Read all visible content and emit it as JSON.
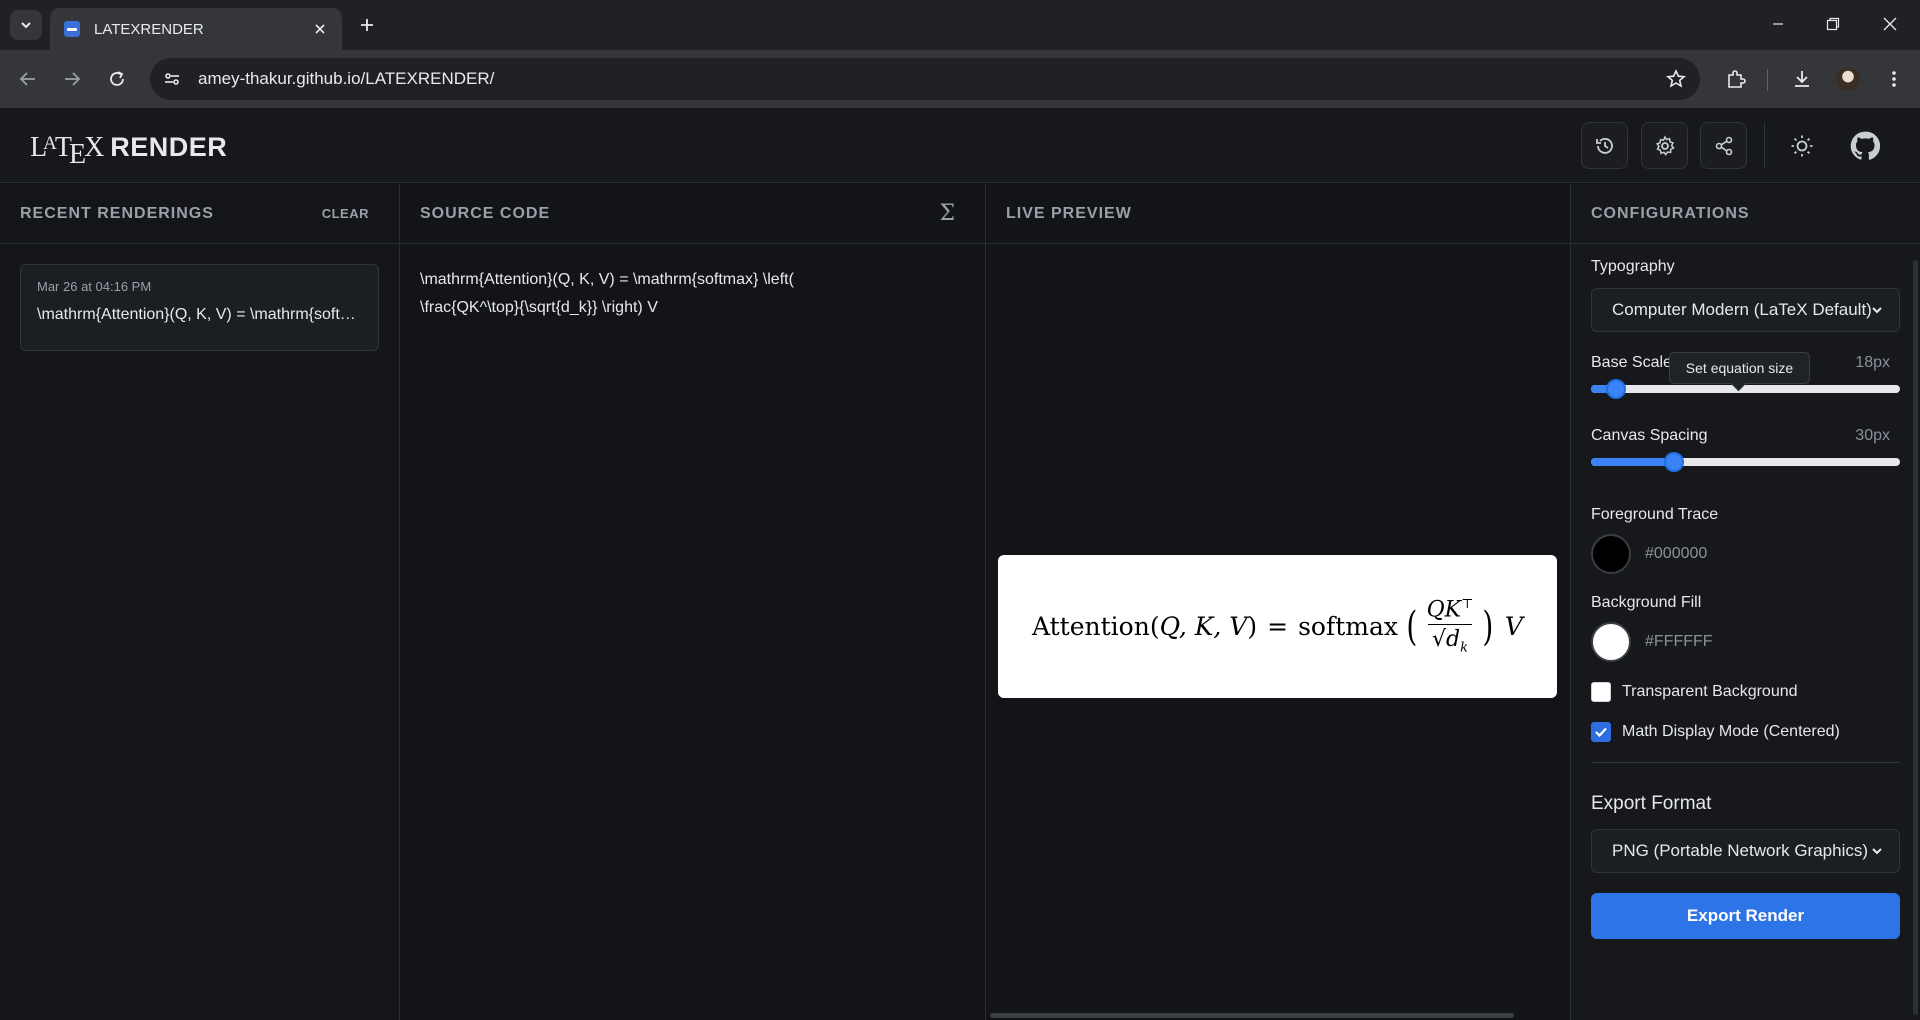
{
  "browser": {
    "tab_title": "LATEXRENDER",
    "url": "amey-thakur.github.io/LATEXRENDER/"
  },
  "app": {
    "logo": {
      "l": "L",
      "a": "A",
      "t": "T",
      "e": "E",
      "x": "X",
      "render": "RENDER"
    }
  },
  "recent": {
    "title": "RECENT RENDERINGS",
    "clear_label": "CLEAR",
    "items": [
      {
        "date": "Mar 26 at 04:16 PM",
        "code": "\\mathrm{Attention}(Q, K, V) = \\mathrm{softmax} \\left( \\frac{QK^\\top}{\\sqrt{d_k}} \\right) V"
      }
    ]
  },
  "source": {
    "title": "SOURCE CODE",
    "code": "\\mathrm{Attention}(Q, K, V) = \\mathrm{softmax} \\left(\n\\frac{QK^\\top}{\\sqrt{d_k}} \\right) V"
  },
  "preview": {
    "title": "LIVE PREVIEW",
    "formula": {
      "attention": "Attention",
      "lparen": "(",
      "args": "Q, K, V",
      "rparen": ")",
      "equals": "=",
      "softmax": "softmax",
      "num": "QK",
      "num_sup": "⊤",
      "den_root": "√",
      "den": "d",
      "den_sub": "k",
      "v": "V"
    }
  },
  "config": {
    "title": "CONFIGURATIONS",
    "typography_label": "Typography",
    "typography_value": "Computer Modern (LaTeX Default)",
    "base_scale_label": "Base Scale",
    "base_scale_value": "18px",
    "base_scale_fraction": 0.08,
    "tooltip": "Set equation size",
    "canvas_spacing_label": "Canvas Spacing",
    "canvas_spacing_value": "30px",
    "canvas_spacing_fraction": 0.27,
    "foreground_label": "Foreground Trace",
    "foreground_hex": "#000000",
    "background_label": "Background Fill",
    "background_hex": "#FFFFFF",
    "transparent_label": "Transparent Background",
    "transparent_checked": false,
    "display_mode_label": "Math Display Mode (Centered)",
    "display_mode_checked": true,
    "export_title": "Export Format",
    "export_format": "PNG (Portable Network Graphics)",
    "export_button": "Export Render"
  },
  "colors": {
    "accent": "#2d74e6",
    "bg": "#16181c"
  }
}
